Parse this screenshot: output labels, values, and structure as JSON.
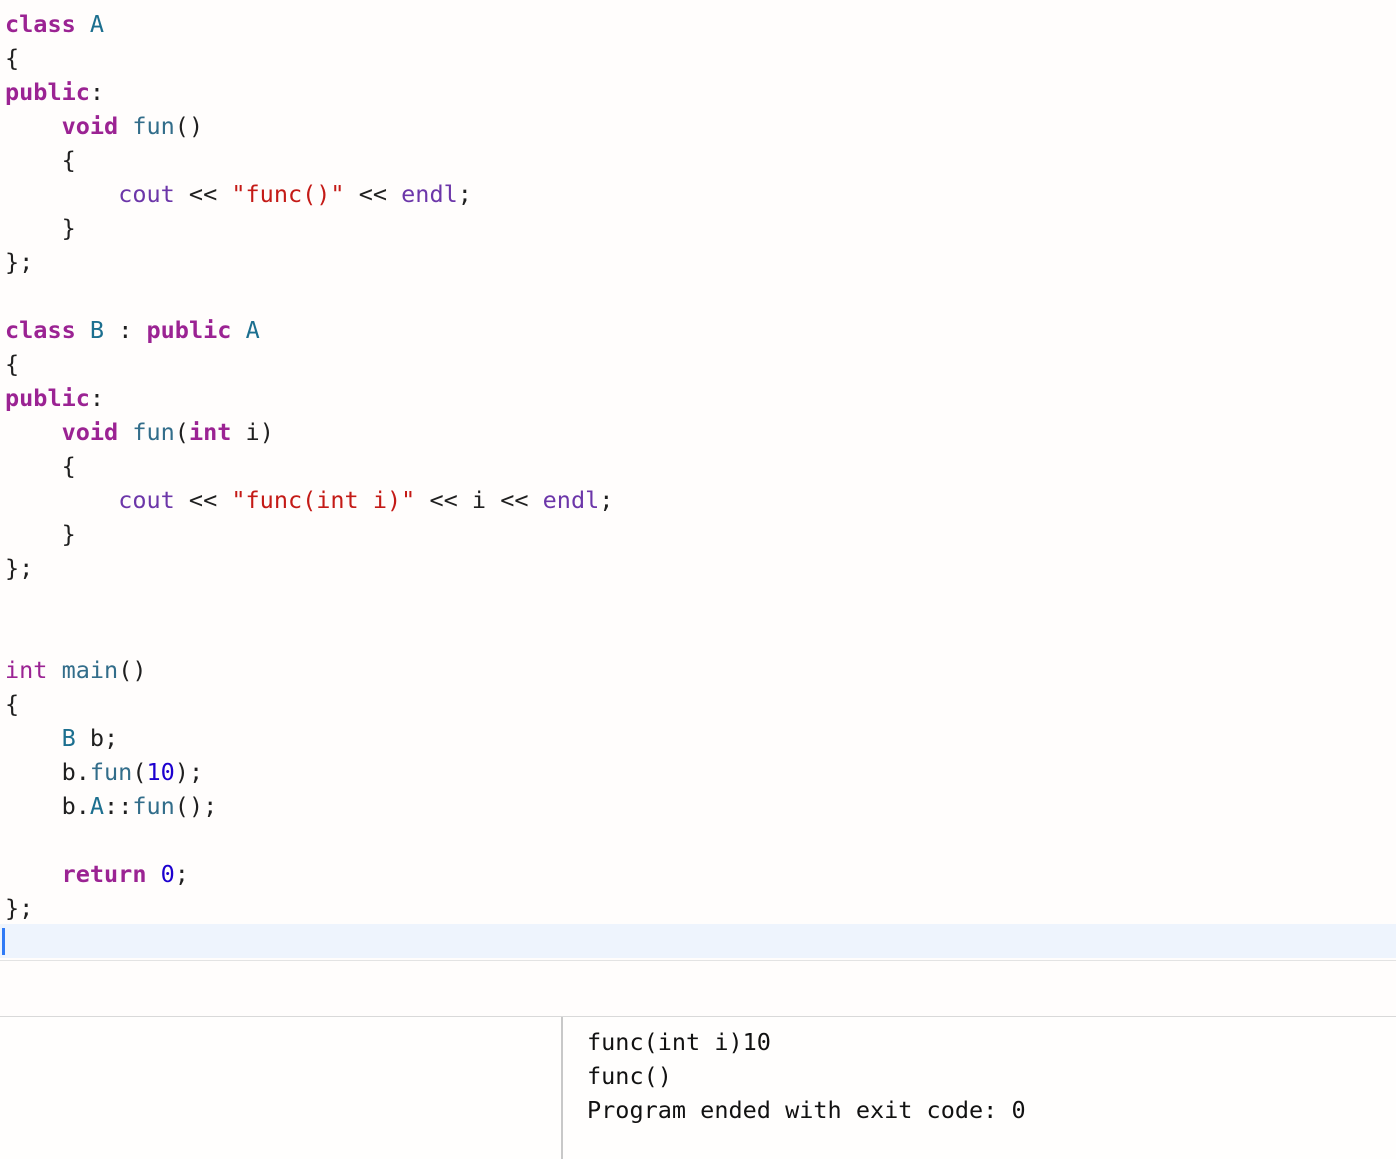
{
  "editor": {
    "lines": [
      [
        {
          "t": "class",
          "c": "kw"
        },
        {
          "t": " ",
          "c": "pl"
        },
        {
          "t": "A",
          "c": "cls"
        }
      ],
      [
        {
          "t": "{",
          "c": "pl"
        }
      ],
      [
        {
          "t": "public",
          "c": "kw"
        },
        {
          "t": ":",
          "c": "pl"
        }
      ],
      [
        {
          "t": "    ",
          "c": "pl"
        },
        {
          "t": "void",
          "c": "kw"
        },
        {
          "t": " ",
          "c": "pl"
        },
        {
          "t": "fun",
          "c": "fn"
        },
        {
          "t": "()",
          "c": "pl"
        }
      ],
      [
        {
          "t": "    {",
          "c": "pl"
        }
      ],
      [
        {
          "t": "        ",
          "c": "pl"
        },
        {
          "t": "cout",
          "c": "lib"
        },
        {
          "t": " << ",
          "c": "pl"
        },
        {
          "t": "\"func()\"",
          "c": "str"
        },
        {
          "t": " << ",
          "c": "pl"
        },
        {
          "t": "endl",
          "c": "lib"
        },
        {
          "t": ";",
          "c": "pl"
        }
      ],
      [
        {
          "t": "    }",
          "c": "pl"
        }
      ],
      [
        {
          "t": "};",
          "c": "pl"
        }
      ],
      [],
      [
        {
          "t": "class",
          "c": "kw"
        },
        {
          "t": " ",
          "c": "pl"
        },
        {
          "t": "B",
          "c": "cls"
        },
        {
          "t": " : ",
          "c": "pl"
        },
        {
          "t": "public",
          "c": "kw"
        },
        {
          "t": " ",
          "c": "pl"
        },
        {
          "t": "A",
          "c": "cls"
        }
      ],
      [
        {
          "t": "{",
          "c": "pl"
        }
      ],
      [
        {
          "t": "public",
          "c": "kw"
        },
        {
          "t": ":",
          "c": "pl"
        }
      ],
      [
        {
          "t": "    ",
          "c": "pl"
        },
        {
          "t": "void",
          "c": "kw"
        },
        {
          "t": " ",
          "c": "pl"
        },
        {
          "t": "fun",
          "c": "fn"
        },
        {
          "t": "(",
          "c": "pl"
        },
        {
          "t": "int",
          "c": "kw"
        },
        {
          "t": " i)",
          "c": "pl"
        }
      ],
      [
        {
          "t": "    {",
          "c": "pl"
        }
      ],
      [
        {
          "t": "        ",
          "c": "pl"
        },
        {
          "t": "cout",
          "c": "lib"
        },
        {
          "t": " << ",
          "c": "pl"
        },
        {
          "t": "\"func(int i)\"",
          "c": "str"
        },
        {
          "t": " << i << ",
          "c": "pl"
        },
        {
          "t": "endl",
          "c": "lib"
        },
        {
          "t": ";",
          "c": "pl"
        }
      ],
      [
        {
          "t": "    }",
          "c": "pl"
        }
      ],
      [
        {
          "t": "};",
          "c": "pl"
        }
      ],
      [],
      [],
      [
        {
          "t": "int",
          "c": "ty"
        },
        {
          "t": " ",
          "c": "pl"
        },
        {
          "t": "main",
          "c": "fn"
        },
        {
          "t": "()",
          "c": "pl"
        }
      ],
      [
        {
          "t": "{",
          "c": "pl"
        }
      ],
      [
        {
          "t": "    ",
          "c": "pl"
        },
        {
          "t": "B",
          "c": "cls"
        },
        {
          "t": " b;",
          "c": "pl"
        }
      ],
      [
        {
          "t": "    b.",
          "c": "pl"
        },
        {
          "t": "fun",
          "c": "fn"
        },
        {
          "t": "(",
          "c": "pl"
        },
        {
          "t": "10",
          "c": "num"
        },
        {
          "t": ");",
          "c": "pl"
        }
      ],
      [
        {
          "t": "    b.",
          "c": "pl"
        },
        {
          "t": "A",
          "c": "cls"
        },
        {
          "t": "::",
          "c": "pl"
        },
        {
          "t": "fun",
          "c": "fn"
        },
        {
          "t": "();",
          "c": "pl"
        }
      ],
      [],
      [
        {
          "t": "    ",
          "c": "pl"
        },
        {
          "t": "return",
          "c": "kw"
        },
        {
          "t": " ",
          "c": "pl"
        },
        {
          "t": "0",
          "c": "num"
        },
        {
          "t": ";",
          "c": "pl"
        }
      ],
      [
        {
          "t": "};",
          "c": "pl"
        }
      ]
    ]
  },
  "console": {
    "output": [
      "func(int i)10",
      "func()",
      "Program ended with exit code: 0"
    ]
  }
}
